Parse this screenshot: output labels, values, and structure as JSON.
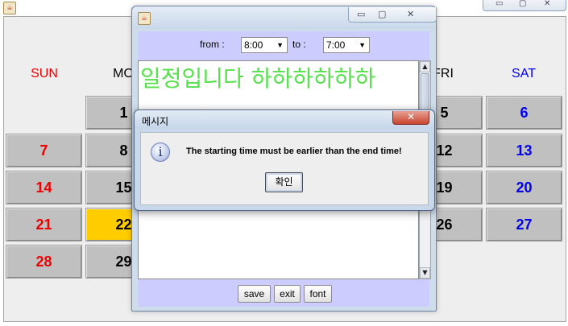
{
  "calendar_window": {
    "icons": {
      "app": "java-icon",
      "minimize": "minimize-icon",
      "maximize": "maximize-icon",
      "close": "close-icon"
    },
    "day_headers": [
      "SUN",
      "MO",
      "FRI",
      "SAT"
    ],
    "cells": [
      "1",
      "5",
      "6",
      "7",
      "8",
      "12",
      "13",
      "14",
      "15",
      "19",
      "20",
      "21",
      "22",
      "26",
      "27",
      "28",
      "29"
    ],
    "today": "22",
    "colors": {
      "sunday": "#ee0000",
      "saturday": "#0000ee",
      "today": "#ffcc00"
    }
  },
  "schedule_window": {
    "icons": {
      "app": "java-icon",
      "minimize": "minimize-icon",
      "maximize": "maximize-icon",
      "close": "close-icon"
    },
    "from_label": "from :",
    "from_value": "8:00",
    "to_label": "to :",
    "to_value": "7:00",
    "text": "일정입니다  하하하하하하",
    "text_color": "#55e14a",
    "buttons": {
      "save": "save",
      "exit": "exit",
      "font": "font"
    }
  },
  "message_dialog": {
    "title": "메시지",
    "icon": "info-icon",
    "message": "The starting time must be earlier than the end time!",
    "ok": "확인"
  }
}
